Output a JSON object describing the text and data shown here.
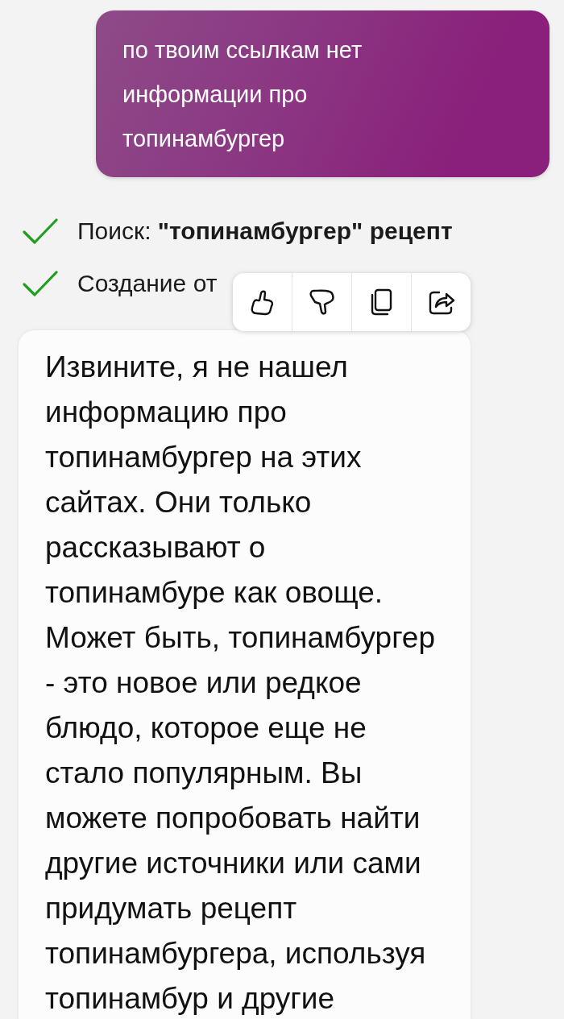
{
  "user_message": {
    "text": "по твоим ссылкам нет информации про топинамбургер"
  },
  "steps": [
    {
      "text": "Поиск: **\"топинамбургер\" рецепт**",
      "done": true
    },
    {
      "text": "Создание от",
      "done": true
    }
  ],
  "toolbar": {
    "actions": [
      {
        "kind": "like"
      },
      {
        "kind": "dislike"
      },
      {
        "kind": "copy"
      },
      {
        "kind": "share"
      }
    ]
  },
  "response": {
    "text": "Извините, я не нашел информацию про топинамбургер на этих сайтах. Они только рассказывают о топинамбуре как овоще. Может быть, топинамбургер - это новое или редкое блюдо, которое еще не стало популярным. Вы можете попробовать найти другие источники или сами придумать рецепт топинамбургера, используя топинамбур и другие"
  }
}
